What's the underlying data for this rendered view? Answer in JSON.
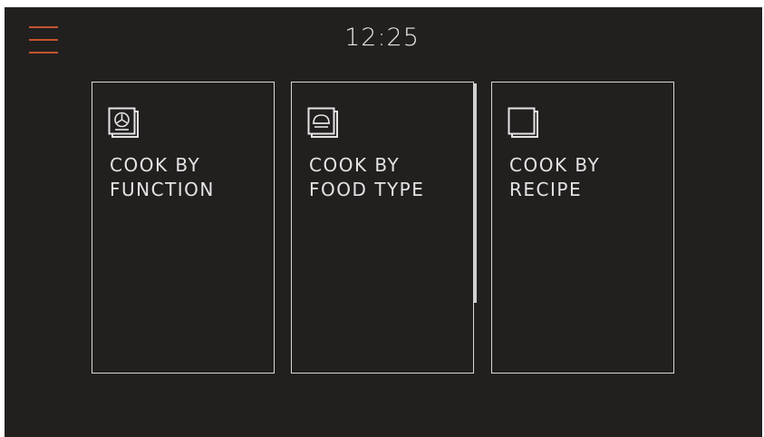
{
  "header": {
    "menu_icon": "hamburger-menu-icon",
    "time": "12:25"
  },
  "cards": [
    {
      "label": "COOK BY\nFUNCTION",
      "icon": "fan-oven-icon"
    },
    {
      "label": "COOK BY\nFOOD TYPE",
      "icon": "food-dish-icon"
    },
    {
      "label": "COOK BY\nRECIPE",
      "icon": "recipe-book-icon"
    }
  ],
  "colors": {
    "background": "#221f1f",
    "accent": "#c2542d",
    "text": "#e4e4e4",
    "card_border": "#d8d8d8"
  }
}
